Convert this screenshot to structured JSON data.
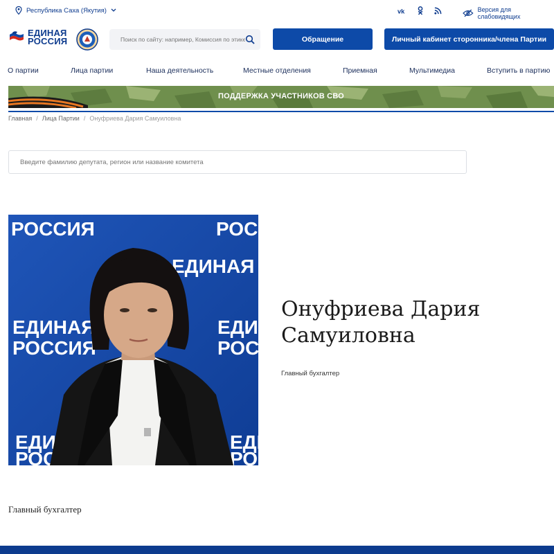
{
  "topbar": {
    "region": "Республика Саха (Якутия)",
    "region_icon": "location-pin-icon",
    "socials": [
      "vk-icon",
      "ok-icon",
      "rss-icon"
    ],
    "vision_label": "Версия для слабовидящих"
  },
  "header": {
    "logo_line1": "ЕДИНАЯ",
    "logo_line2": "РОССИЯ",
    "search_placeholder": "Поиск по сайту: например, Комиссия по этике",
    "appeal_label": "Обращение",
    "cabinet_label": "Личный кабинет сторонника/члена Партии"
  },
  "nav": {
    "items": [
      "О партии",
      "Лица партии",
      "Наша деятельность",
      "Местные отделения",
      "Приемная",
      "Мультимедиа",
      "Вступить в партию"
    ]
  },
  "banner": {
    "label": "ПОДДЕРЖКА УЧАСТНИКОВ СВО"
  },
  "breadcrumb": {
    "home": "Главная",
    "section": "Лица Партии",
    "current": "Онуфриева Дария Самуиловна"
  },
  "deputy_search": {
    "placeholder": "Введите фамилию депутата, регион или название комитета"
  },
  "photo": {
    "backdrop_text_1": "ЕДИНАЯ",
    "backdrop_text_2": "РОССИЯ"
  },
  "person": {
    "name_line1": "Онуфриева Дария",
    "name_line2": "Самуиловна",
    "position": "Главный бухгалтер",
    "bio": "Главный бухгалтер"
  },
  "colors": {
    "brand_blue": "#0d4aa8",
    "dark_blue": "#0d3b8e",
    "banner_green": "#6e8f4b"
  }
}
